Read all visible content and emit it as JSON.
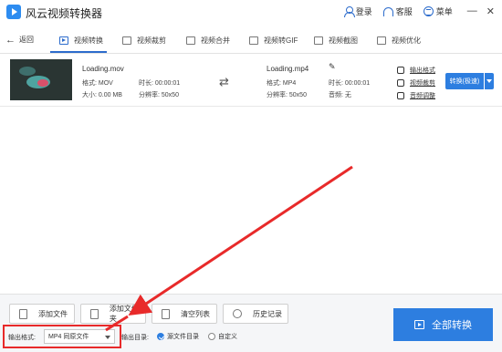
{
  "titlebar": {
    "app_title": "风云视频转换器",
    "login": "登录",
    "service": "客服",
    "menu": "菜单",
    "minimize": "—",
    "close": "✕"
  },
  "nav": {
    "back": "返回",
    "tabs": [
      {
        "label": "视频转换",
        "icon": "video-convert-icon",
        "active": true
      },
      {
        "label": "视频裁剪",
        "icon": "video-crop-icon",
        "active": false
      },
      {
        "label": "视频合并",
        "icon": "video-merge-icon",
        "active": false
      },
      {
        "label": "视频转GIF",
        "icon": "gif-icon",
        "active": false
      },
      {
        "label": "视频截图",
        "icon": "screenshot-icon",
        "active": false
      },
      {
        "label": "视频优化",
        "icon": "optimize-icon",
        "active": false
      }
    ]
  },
  "file": {
    "source": {
      "name": "Loading.mov",
      "format": "格式: MOV",
      "duration": "时长: 00:00:01",
      "size": "大小: 0.00 MB",
      "resolution": "分辨率: 50x50"
    },
    "target": {
      "name": "Loading.mp4",
      "format": "格式: MP4",
      "duration": "时长: 00:00:01",
      "resolution": "分辨率: 50x50",
      "audio": "音频: 无"
    },
    "links": {
      "output_format": "输出格式",
      "video_crop": "视频裁剪",
      "audio_adjust": "音频调整"
    },
    "convert_button": "转换(极速)"
  },
  "bottom": {
    "add_file": "添加文件",
    "add_folder": "添加文件夹",
    "clear_list": "清空列表",
    "history": "历史记录",
    "output_format_label": "输出格式:",
    "output_format_value": "MP4 同原文件",
    "output_dir_label": "输出目录:",
    "radio_source": "源文件目录",
    "radio_custom": "自定义",
    "convert_all": "全部转换"
  },
  "colors": {
    "accent": "#2d7ee0",
    "annotation": "#e82a2a"
  }
}
